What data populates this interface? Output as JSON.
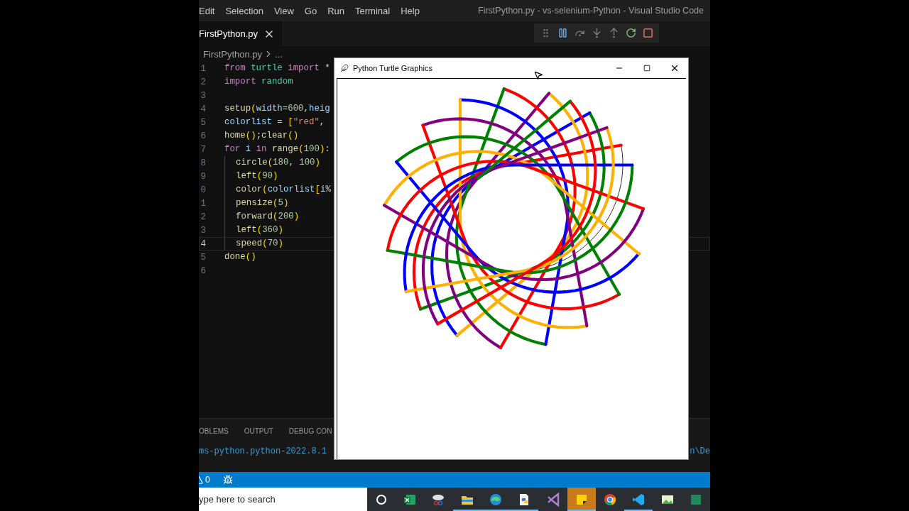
{
  "menu": [
    "Edit",
    "Selection",
    "View",
    "Go",
    "Run",
    "Terminal",
    "Help"
  ],
  "window_title": "FirstPython.py - vs-selenium-Python - Visual Studio Code",
  "tabs": [
    {
      "label": "FirstPython.py",
      "selected": true
    }
  ],
  "breadcrumb": [
    "FirstPython.py",
    "..."
  ],
  "code_lines": [
    {
      "number": "1",
      "current": false,
      "indented": false,
      "tokens": [
        {
          "kind": "keyword",
          "text": "from "
        },
        {
          "kind": "module",
          "text": "turtle "
        },
        {
          "kind": "keyword",
          "text": "import "
        },
        {
          "kind": "plain",
          "text": "*"
        }
      ]
    },
    {
      "number": "2",
      "current": false,
      "indented": false,
      "tokens": [
        {
          "kind": "keyword",
          "text": "import "
        },
        {
          "kind": "module",
          "text": "random"
        }
      ]
    },
    {
      "number": "3",
      "current": false,
      "indented": false
    },
    {
      "number": "4",
      "current": false,
      "indented": false,
      "tokens": [
        {
          "kind": "func",
          "text": "setup"
        },
        {
          "kind": "bracket",
          "text": "("
        },
        {
          "kind": "var",
          "text": "width"
        },
        {
          "kind": "plain",
          "text": "="
        },
        {
          "kind": "number",
          "text": "600"
        },
        {
          "kind": "plain",
          "text": ","
        },
        {
          "kind": "var",
          "text": "heig"
        }
      ]
    },
    {
      "number": "5",
      "current": false,
      "indented": false,
      "tokens": [
        {
          "kind": "var",
          "text": "colorlist"
        },
        {
          "kind": "plain",
          "text": " = "
        },
        {
          "kind": "bracket",
          "text": "["
        },
        {
          "kind": "string",
          "text": "\"red\""
        },
        {
          "kind": "plain",
          "text": ","
        }
      ]
    },
    {
      "number": "6",
      "current": false,
      "indented": false,
      "tokens": [
        {
          "kind": "func",
          "text": "home"
        },
        {
          "kind": "bracket",
          "text": "()"
        },
        {
          "kind": "plain",
          "text": ";"
        },
        {
          "kind": "func",
          "text": "clear"
        },
        {
          "kind": "bracket",
          "text": "()"
        }
      ]
    },
    {
      "number": "7",
      "current": false,
      "indented": false,
      "tokens": [
        {
          "kind": "keyword",
          "text": "for "
        },
        {
          "kind": "var",
          "text": "i "
        },
        {
          "kind": "keyword",
          "text": "in "
        },
        {
          "kind": "func",
          "text": "range"
        },
        {
          "kind": "bracket",
          "text": "("
        },
        {
          "kind": "number",
          "text": "100"
        },
        {
          "kind": "bracket",
          "text": ")"
        },
        {
          "kind": "plain",
          "text": ":"
        }
      ]
    },
    {
      "number": "8",
      "current": false,
      "indented": true,
      "tokens": [
        {
          "kind": "func",
          "text": "circle"
        },
        {
          "kind": "bracket",
          "text": "("
        },
        {
          "kind": "number",
          "text": "180"
        },
        {
          "kind": "plain",
          "text": ", "
        },
        {
          "kind": "number",
          "text": "100"
        },
        {
          "kind": "bracket",
          "text": ")"
        }
      ]
    },
    {
      "number": "9",
      "current": false,
      "indented": true,
      "tokens": [
        {
          "kind": "func",
          "text": "left"
        },
        {
          "kind": "bracket",
          "text": "("
        },
        {
          "kind": "number",
          "text": "90"
        },
        {
          "kind": "bracket",
          "text": ")"
        }
      ]
    },
    {
      "number": "0",
      "current": false,
      "indented": true,
      "tokens": [
        {
          "kind": "func",
          "text": "color"
        },
        {
          "kind": "bracket",
          "text": "("
        },
        {
          "kind": "var",
          "text": "colorlist"
        },
        {
          "kind": "bracket",
          "text": "["
        },
        {
          "kind": "var",
          "text": "i"
        },
        {
          "kind": "plain",
          "text": "%"
        }
      ]
    },
    {
      "number": "1",
      "current": false,
      "indented": true,
      "tokens": [
        {
          "kind": "func",
          "text": "pensize"
        },
        {
          "kind": "bracket",
          "text": "("
        },
        {
          "kind": "number",
          "text": "5"
        },
        {
          "kind": "bracket",
          "text": ")"
        }
      ]
    },
    {
      "number": "2",
      "current": false,
      "indented": true,
      "tokens": [
        {
          "kind": "func",
          "text": "forward"
        },
        {
          "kind": "bracket",
          "text": "("
        },
        {
          "kind": "number",
          "text": "200"
        },
        {
          "kind": "bracket",
          "text": ")"
        }
      ]
    },
    {
      "number": "3",
      "current": false,
      "indented": true,
      "tokens": [
        {
          "kind": "func",
          "text": "left"
        },
        {
          "kind": "bracket",
          "text": "("
        },
        {
          "kind": "number",
          "text": "360"
        },
        {
          "kind": "bracket",
          "text": ")"
        }
      ]
    },
    {
      "number": "4",
      "current": true,
      "indented": true,
      "tokens": [
        {
          "kind": "func",
          "text": "speed"
        },
        {
          "kind": "bracket",
          "text": "("
        },
        {
          "kind": "number",
          "text": "70"
        },
        {
          "kind": "bracket",
          "text": ")"
        }
      ]
    },
    {
      "number": "5",
      "current": false,
      "indented": false,
      "tokens": [
        {
          "kind": "func",
          "text": "done"
        },
        {
          "kind": "bracket",
          "text": "()"
        }
      ]
    },
    {
      "number": "6",
      "current": false,
      "indented": false
    }
  ],
  "panel": {
    "tabs": [
      "OBLEMS",
      "OUTPUT",
      "DEBUG CON"
    ],
    "terminal_left": "ms-python.python-2022.8.1",
    "terminal_right": "n\\De"
  },
  "status_bar": {
    "warnings": "0"
  },
  "taskbar": {
    "search_placeholder": "ype here to search",
    "apps": [
      {
        "kind": "cortana",
        "running": false,
        "selected": false
      },
      {
        "kind": "spreadsheet",
        "running": false,
        "selected": false
      },
      {
        "kind": "snip",
        "running": false,
        "selected": false
      },
      {
        "kind": "folder",
        "running": true,
        "selected": false
      },
      {
        "kind": "browser-wave",
        "running": true,
        "selected": false
      },
      {
        "kind": "python-file",
        "running": true,
        "selected": false
      },
      {
        "kind": "studio",
        "running": false,
        "selected": false
      },
      {
        "kind": "note",
        "running": true,
        "selected": true
      },
      {
        "kind": "browser-ball",
        "running": false,
        "selected": false
      },
      {
        "kind": "code",
        "running": true,
        "selected": false
      },
      {
        "kind": "picture",
        "running": false,
        "selected": false
      },
      {
        "kind": "generic",
        "running": false,
        "selected": false
      }
    ]
  },
  "turtle_window": {
    "title": "Python Turtle Graphics"
  }
}
